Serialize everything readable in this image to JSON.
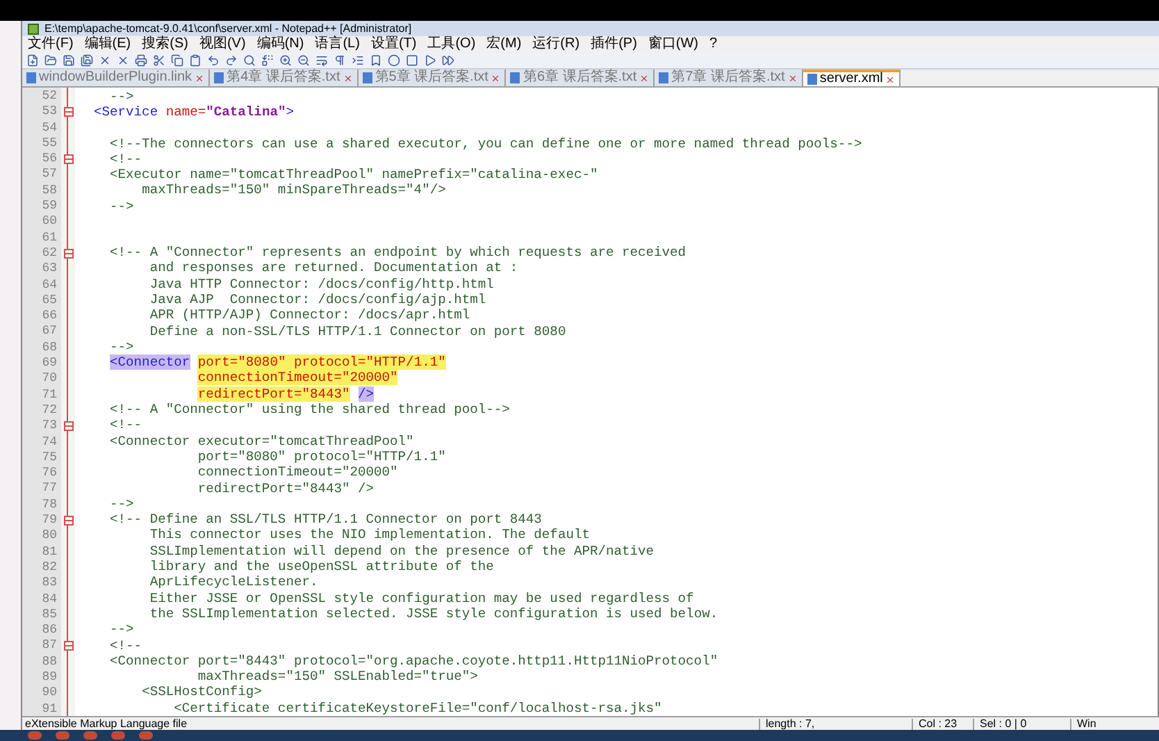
{
  "window": {
    "title": "E:\\temp\\apache-tomcat-9.0.41\\conf\\server.xml - Notepad++ [Administrator]"
  },
  "menu": [
    "文件(F)",
    "编辑(E)",
    "搜索(S)",
    "视图(V)",
    "编码(N)",
    "语言(L)",
    "设置(T)",
    "工具(O)",
    "宏(M)",
    "运行(R)",
    "插件(P)",
    "窗口(W)",
    "?"
  ],
  "tabs": [
    {
      "label": "windowBuilderPlugin.link",
      "selected": false
    },
    {
      "label": "第4章 课后答案.txt",
      "selected": false
    },
    {
      "label": "第5章 课后答案.txt",
      "selected": false
    },
    {
      "label": "第6章 课后答案.txt",
      "selected": false
    },
    {
      "label": "第7章 课后答案.txt",
      "selected": false
    },
    {
      "label": "server.xml",
      "selected": true
    }
  ],
  "editor": {
    "lines": [
      {
        "number": "52",
        "fold": false,
        "tokens": [
          {
            "text": "    -->",
            "kind": "comment"
          }
        ]
      },
      {
        "number": "53",
        "fold": true,
        "tokens": [
          {
            "text": "  <Service",
            "kind": "tag"
          },
          {
            "text": " name=",
            "kind": "attr"
          },
          {
            "text": "\"Catalina\"",
            "kind": "value"
          },
          {
            "text": ">",
            "kind": "tag"
          }
        ]
      },
      {
        "number": "54",
        "fold": false
      },
      {
        "number": "55",
        "fold": false,
        "tokens": [
          {
            "text": "    <!--The connectors can use a shared executor, you can define one or more named thread pools-->",
            "kind": "comment"
          }
        ]
      },
      {
        "number": "56",
        "fold": true,
        "tokens": [
          {
            "text": "    <!--",
            "kind": "comment"
          }
        ]
      },
      {
        "number": "57",
        "fold": false,
        "tokens": [
          {
            "text": "    <Executor name=\"tomcatThreadPool\" namePrefix=\"catalina-exec-\"",
            "kind": "comment"
          }
        ]
      },
      {
        "number": "58",
        "fold": false,
        "tokens": [
          {
            "text": "        maxThreads=\"150\" minSpareThreads=\"4\"/>",
            "kind": "comment"
          }
        ]
      },
      {
        "number": "59",
        "fold": false,
        "tokens": [
          {
            "text": "    -->",
            "kind": "comment"
          }
        ]
      },
      {
        "number": "60",
        "fold": false
      },
      {
        "number": "61",
        "fold": false
      },
      {
        "number": "62",
        "fold": true,
        "tokens": [
          {
            "text": "    <!-- A \"Connector\" represents an endpoint by which requests are received",
            "kind": "comment"
          }
        ]
      },
      {
        "number": "63",
        "fold": false,
        "tokens": [
          {
            "text": "         and responses are returned. Documentation at :",
            "kind": "comment"
          }
        ]
      },
      {
        "number": "64",
        "fold": false,
        "tokens": [
          {
            "text": "         Java HTTP Connector: /docs/config/http.html",
            "kind": "comment"
          }
        ]
      },
      {
        "number": "65",
        "fold": false,
        "tokens": [
          {
            "text": "         Java AJP  Connector: /docs/config/ajp.html",
            "kind": "comment"
          }
        ]
      },
      {
        "number": "66",
        "fold": false,
        "tokens": [
          {
            "text": "         APR (HTTP/AJP) Connector: /docs/apr.html",
            "kind": "comment"
          }
        ]
      },
      {
        "number": "67",
        "fold": false,
        "tokens": [
          {
            "text": "         Define a non-SSL/TLS HTTP/1.1 Connector on port 8080",
            "kind": "comment"
          }
        ]
      },
      {
        "number": "68",
        "fold": false,
        "tokens": [
          {
            "text": "    -->",
            "kind": "comment"
          }
        ]
      },
      {
        "number": "69",
        "fold": false,
        "tokens": [
          {
            "text": "    <Connector",
            "kind": "tag",
            "highlighted": true
          },
          {
            "text": " port=\"8080\" protocol=\"HTTP/1.1\"",
            "kind": "attr",
            "highlighted": true
          }
        ]
      },
      {
        "number": "70",
        "fold": false,
        "tokens": [
          {
            "text": "               connectionTimeout=\"20000\"",
            "kind": "attr",
            "highlighted": true
          }
        ]
      },
      {
        "number": "71",
        "fold": false,
        "tokens": [
          {
            "text": "               redirectPort=\"8443\"",
            "kind": "attr",
            "highlighted": true
          },
          {
            "text": " />",
            "kind": "tag",
            "highlighted": true
          }
        ]
      },
      {
        "number": "72",
        "fold": false,
        "tokens": [
          {
            "text": "    <!-- A \"Connector\" using the shared thread pool-->",
            "kind": "comment"
          }
        ]
      },
      {
        "number": "73",
        "fold": true,
        "tokens": [
          {
            "text": "    <!--",
            "kind": "comment"
          }
        ]
      },
      {
        "number": "74",
        "fold": false,
        "tokens": [
          {
            "text": "    <Connector executor=\"tomcatThreadPool\"",
            "kind": "comment"
          }
        ]
      },
      {
        "number": "75",
        "fold": false,
        "tokens": [
          {
            "text": "               port=\"8080\" protocol=\"HTTP/1.1\"",
            "kind": "comment"
          }
        ]
      },
      {
        "number": "76",
        "fold": false,
        "tokens": [
          {
            "text": "               connectionTimeout=\"20000\"",
            "kind": "comment"
          }
        ]
      },
      {
        "number": "77",
        "fold": false,
        "tokens": [
          {
            "text": "               redirectPort=\"8443\" />",
            "kind": "comment"
          }
        ]
      },
      {
        "number": "78",
        "fold": false,
        "tokens": [
          {
            "text": "    -->",
            "kind": "comment"
          }
        ]
      },
      {
        "number": "79",
        "fold": true,
        "tokens": [
          {
            "text": "    <!-- Define an SSL/TLS HTTP/1.1 Connector on port 8443",
            "kind": "comment"
          }
        ]
      },
      {
        "number": "80",
        "fold": false,
        "tokens": [
          {
            "text": "         This connector uses the NIO implementation. The default",
            "kind": "comment"
          }
        ]
      },
      {
        "number": "81",
        "fold": false,
        "tokens": [
          {
            "text": "         SSLImplementation will depend on the presence of the APR/native",
            "kind": "comment"
          }
        ]
      },
      {
        "number": "82",
        "fold": false,
        "tokens": [
          {
            "text": "         library and the useOpenSSL attribute of the",
            "kind": "comment"
          }
        ]
      },
      {
        "number": "83",
        "fold": false,
        "tokens": [
          {
            "text": "         AprLifecycleListener.",
            "kind": "comment"
          }
        ]
      },
      {
        "number": "84",
        "fold": false,
        "tokens": [
          {
            "text": "         Either JSSE or OpenSSL style configuration may be used regardless of",
            "kind": "comment"
          }
        ]
      },
      {
        "number": "85",
        "fold": false,
        "tokens": [
          {
            "text": "         the SSLImplementation selected. JSSE style configuration is used below.",
            "kind": "comment"
          }
        ]
      },
      {
        "number": "86",
        "fold": false,
        "tokens": [
          {
            "text": "    -->",
            "kind": "comment"
          }
        ]
      },
      {
        "number": "87",
        "fold": true,
        "tokens": [
          {
            "text": "    <!--",
            "kind": "comment"
          }
        ]
      },
      {
        "number": "88",
        "fold": false,
        "tokens": [
          {
            "text": "    <Connector port=\"8443\" protocol=\"org.apache.coyote.http11.Http11NioProtocol\"",
            "kind": "comment"
          }
        ]
      },
      {
        "number": "89",
        "fold": false,
        "tokens": [
          {
            "text": "               maxThreads=\"150\" SSLEnabled=\"true\">",
            "kind": "comment"
          }
        ]
      },
      {
        "number": "90",
        "fold": false,
        "tokens": [
          {
            "text": "        <SSLHostConfig>",
            "kind": "comment"
          }
        ]
      },
      {
        "number": "91",
        "fold": false,
        "tokens": [
          {
            "text": "            <Certificate certificateKeystoreFile=\"conf/localhost-rsa.jks\"",
            "kind": "comment"
          }
        ]
      }
    ]
  },
  "status_bar": {
    "file_type": "eXtensible Markup Language file",
    "length": "length : 7,",
    "column": "Col : 23",
    "selection": "Sel : 0 | 0",
    "cut_text": "Win"
  }
}
